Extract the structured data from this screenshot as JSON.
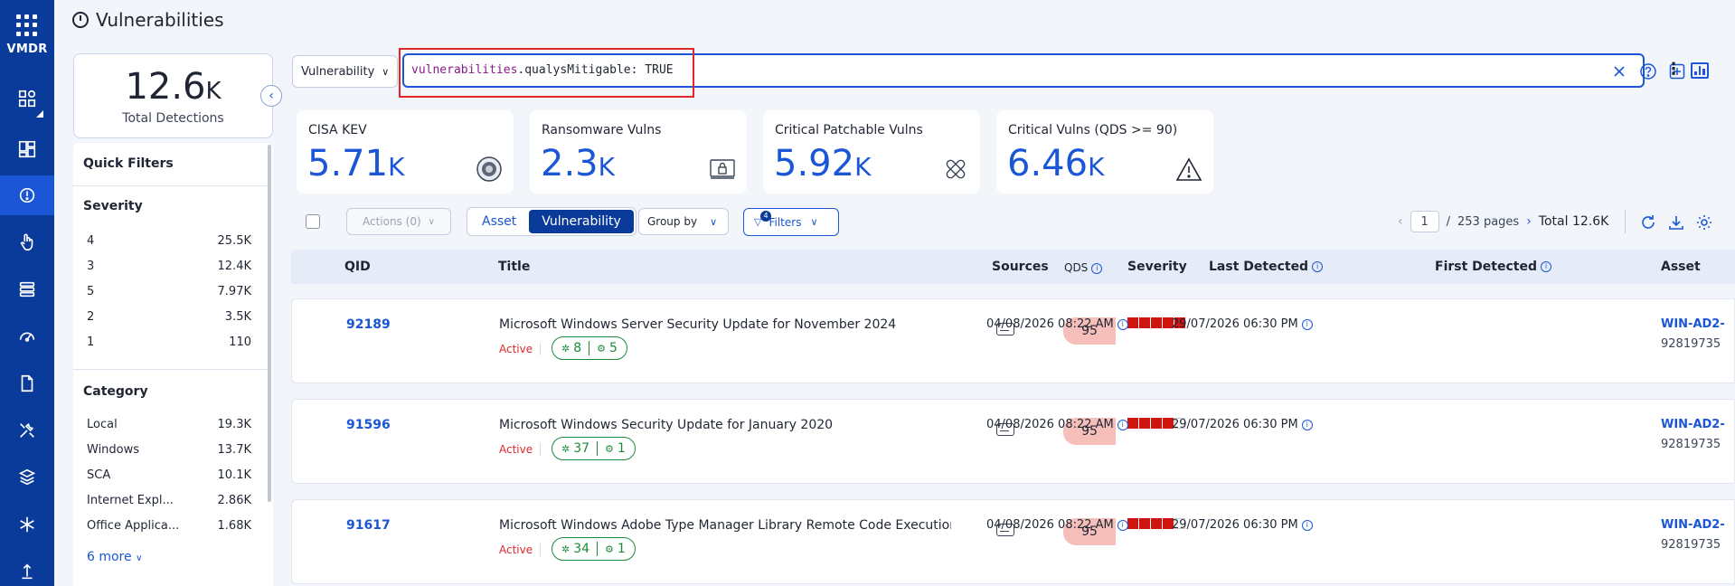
{
  "app": {
    "brand": "VMDR"
  },
  "header": {
    "title": "Vulnerabilities"
  },
  "summary": {
    "total_value": "12.6",
    "total_suffix": "K",
    "total_label": "Total Detections"
  },
  "quick_filters": {
    "title": "Quick Filters",
    "severity": {
      "title": "Severity",
      "items": [
        {
          "label": "4",
          "count": "25.5K"
        },
        {
          "label": "3",
          "count": "12.4K"
        },
        {
          "label": "5",
          "count": "7.97K"
        },
        {
          "label": "2",
          "count": "3.5K"
        },
        {
          "label": "1",
          "count": "110"
        }
      ]
    },
    "category": {
      "title": "Category",
      "items": [
        {
          "label": "Local",
          "count": "19.3K"
        },
        {
          "label": "Windows",
          "count": "13.7K"
        },
        {
          "label": "SCA",
          "count": "10.1K"
        },
        {
          "label": "Internet Expl...",
          "count": "2.86K"
        },
        {
          "label": "Office Applica...",
          "count": "1.68K"
        }
      ],
      "more": "6 more"
    }
  },
  "search": {
    "scope": "Vulnerability",
    "query_key": "vulnerabilities",
    "query_rest": ".qualysMitigable: TRUE"
  },
  "kpis": [
    {
      "label": "CISA KEV",
      "value": "5.71",
      "suffix": "K",
      "icon": "cisa-seal-icon"
    },
    {
      "label": "Ransomware Vulns",
      "value": "2.3",
      "suffix": "K",
      "icon": "ransomware-icon"
    },
    {
      "label": "Critical Patchable Vulns",
      "value": "5.92",
      "suffix": "K",
      "icon": "patch-bandage-icon"
    },
    {
      "label": "Critical Vulns (QDS >= 90)",
      "value": "6.46",
      "suffix": "K",
      "icon": "warning-icon"
    }
  ],
  "toolbar": {
    "actions": "Actions (0)",
    "view_asset": "Asset",
    "view_vulnerability": "Vulnerability",
    "group_by": "Group by",
    "filters": "Filters",
    "filters_count": "4",
    "page": "1",
    "pages": "253 pages",
    "total": "Total 12.6K"
  },
  "table": {
    "columns": {
      "qid": "QID",
      "title": "Title",
      "sources": "Sources",
      "qds": "QDS",
      "severity": "Severity",
      "last_detected": "Last Detected",
      "first_detected": "First Detected",
      "asset": "Asset"
    },
    "rows": [
      {
        "qid": "92189",
        "title": "Microsoft Windows Server Security Update for November 2024",
        "status": "Active",
        "count_a": "8",
        "count_b": "5",
        "qds": "95",
        "severity": 5,
        "last_detected": "04/08/2026 08:22 AM",
        "first_detected": "29/07/2026 06:30 PM",
        "asset_name": "WIN-AD2-",
        "asset_id": "92819735"
      },
      {
        "qid": "91596",
        "title": "Microsoft Windows Security Update for January 2020",
        "status": "Active",
        "count_a": "37",
        "count_b": "1",
        "qds": "95",
        "severity": 4,
        "last_detected": "04/08/2026 08:22 AM",
        "first_detected": "29/07/2026 06:30 PM",
        "asset_name": "WIN-AD2-",
        "asset_id": "92819735"
      },
      {
        "qid": "91617",
        "title": "Microsoft Windows Adobe Type Manager Library Remote Code Execution ...",
        "status": "Active",
        "count_a": "34",
        "count_b": "1",
        "qds": "95",
        "severity": 4,
        "last_detected": "04/08/2026 08:22 AM",
        "first_detected": "29/07/2026 06:30 PM",
        "asset_name": "WIN-AD2-",
        "asset_id": "92819735"
      }
    ]
  },
  "colors": {
    "brand": "#0b3b9a",
    "accent": "#1a56d6",
    "critical": "#d0140f",
    "positive": "#1d8a3a"
  }
}
